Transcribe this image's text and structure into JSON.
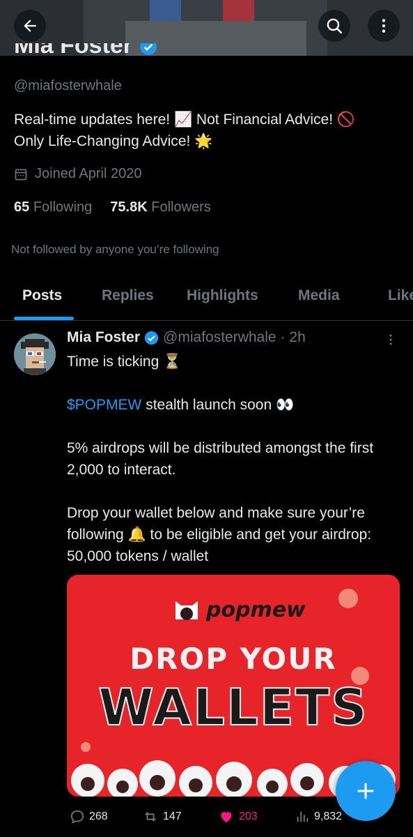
{
  "header": {
    "back_icon": "arrow-left-icon",
    "search_icon": "search-icon",
    "more_icon": "more-vertical-icon"
  },
  "profile": {
    "name": "Mia Foster",
    "handle": "@miafosterwhale",
    "bio_line1": "Real-time updates here! 📈 Not Financial Advice! 🚫",
    "bio_line2": "Only Life-Changing Advice! 🌟",
    "joined": "Joined April 2020",
    "following_count": "65",
    "following_label": "Following",
    "followers_count": "75.8K",
    "followers_label": "Followers",
    "not_followed": "Not followed by anyone you’re following"
  },
  "tabs": [
    {
      "label": "Posts",
      "active": true
    },
    {
      "label": "Replies",
      "active": false
    },
    {
      "label": "Highlights",
      "active": false
    },
    {
      "label": "Media",
      "active": false
    },
    {
      "label": "Likes",
      "active": false
    }
  ],
  "post": {
    "author": "Mia Foster",
    "handle": "@miafosterwhale",
    "time": "· 2h",
    "line1": "Time is ticking ⏳",
    "cashtag": "$POPMEW",
    "line2_rest": " stealth launch soon 👀",
    "line3": "5% airdrops will be distributed amongst the first 2,000 to interact.",
    "line4": "Drop your wallet below and make sure your’re following 🔔 to be eligible and get your airdrop: 50,000 tokens / wallet",
    "media": {
      "logo_text": "popmew",
      "headline1": "DROP YOUR",
      "headline2": "WALLETS"
    },
    "replies": "268",
    "reposts": "147",
    "likes": "203",
    "views": "9,832"
  },
  "colors": {
    "accent": "#1d9bf0",
    "like": "#f91880",
    "muted": "#71767b",
    "media_bg": "#e8242b"
  }
}
